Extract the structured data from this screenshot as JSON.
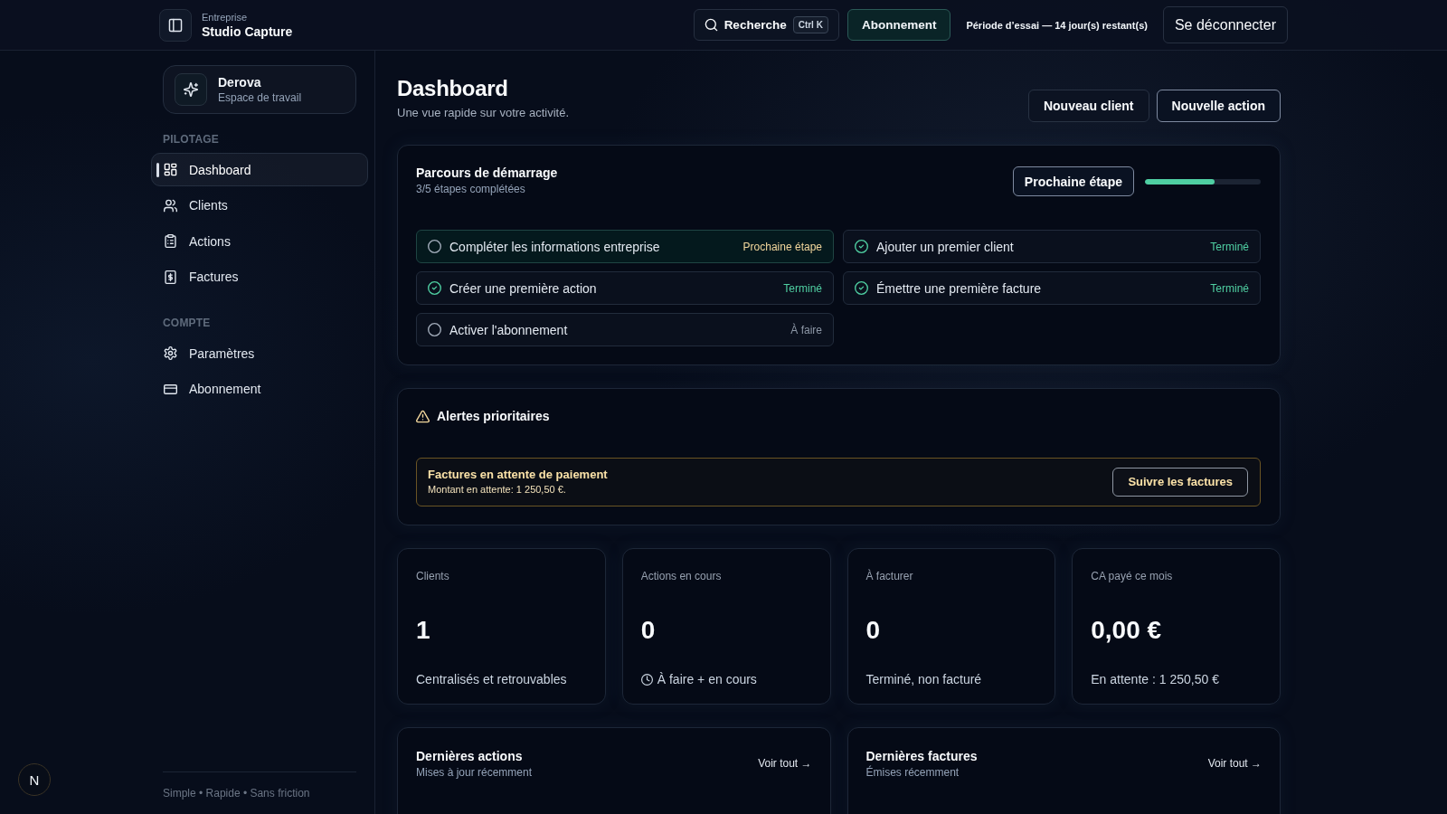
{
  "top_bar": {
    "company_label": "Entreprise",
    "company_name": "Studio Capture",
    "search": {
      "label": "Recherche",
      "shortcut": "Ctrl K"
    },
    "subscription_button": "Abonnement",
    "trial_notice": "Période d’essai — 14 jour(s) restant(s)",
    "logout_button": "Se déconnecter"
  },
  "sidebar": {
    "workspace": {
      "name": "Derova",
      "subtitle": "Espace de travail"
    },
    "sections": [
      {
        "title": "PILOTAGE",
        "items": [
          {
            "label": "Dashboard",
            "selected": true
          },
          {
            "label": "Clients",
            "selected": false
          },
          {
            "label": "Actions",
            "selected": false
          },
          {
            "label": "Factures",
            "selected": false
          }
        ]
      },
      {
        "title": "COMPTE",
        "items": [
          {
            "label": "Paramètres",
            "selected": false
          },
          {
            "label": "Abonnement",
            "selected": false
          }
        ]
      }
    ],
    "footer": "Simple • Rapide • Sans friction"
  },
  "page_header": {
    "title": "Dashboard",
    "subtitle": "Une vue rapide sur votre activité.",
    "buttons": [
      {
        "label": "Nouveau client",
        "kind": "secondary"
      },
      {
        "label": "Nouvelle action",
        "kind": "primary"
      }
    ]
  },
  "onboarding": {
    "title": "Parcours de démarrage",
    "subtitle": "3/5 étapes complétées",
    "next_button": "Prochaine étape",
    "progress": {
      "level": 0.6
    },
    "steps": [
      {
        "label": "Compléter les informations entreprise",
        "done": false,
        "current": true,
        "status_label": "Prochaine étape"
      },
      {
        "label": "Ajouter un premier client",
        "done": true,
        "current": false,
        "status_label": "Terminé"
      },
      {
        "label": "Créer une première action",
        "done": true,
        "current": false,
        "status_label": "Terminé"
      },
      {
        "label": "Émettre une première facture",
        "done": true,
        "current": false,
        "status_label": "Terminé"
      },
      {
        "label": "Activer l'abonnement",
        "done": false,
        "current": false,
        "status_label": "À faire"
      }
    ]
  },
  "alerts": {
    "title": "Alertes prioritaires",
    "items": [
      {
        "title": "Factures en attente de paiement",
        "detail": "Montant en attente: 1 250,50 €.",
        "button": "Suivre les factures"
      }
    ]
  },
  "stats": [
    {
      "label": "Clients",
      "value": "1",
      "note": "Centralisés et retrouvables",
      "kind": "plain"
    },
    {
      "label": "Actions en cours",
      "value": "0",
      "note": "À faire + en cours",
      "kind": "timed"
    },
    {
      "label": "À facturer",
      "value": "0",
      "note": "Terminé, non facturé",
      "kind": "plain"
    },
    {
      "label": "CA payé ce mois",
      "value": "0,00 €",
      "note": "En attente : 1 250,50 €",
      "kind": "plain"
    }
  ],
  "recent": [
    {
      "title": "Dernières actions",
      "subtitle": "Mises à jour récemment",
      "link": "Voir tout →"
    },
    {
      "title": "Dernières factures",
      "subtitle": "Émises récemment",
      "link": "Voir tout →"
    }
  ],
  "dev_badge": {
    "label": "N"
  }
}
